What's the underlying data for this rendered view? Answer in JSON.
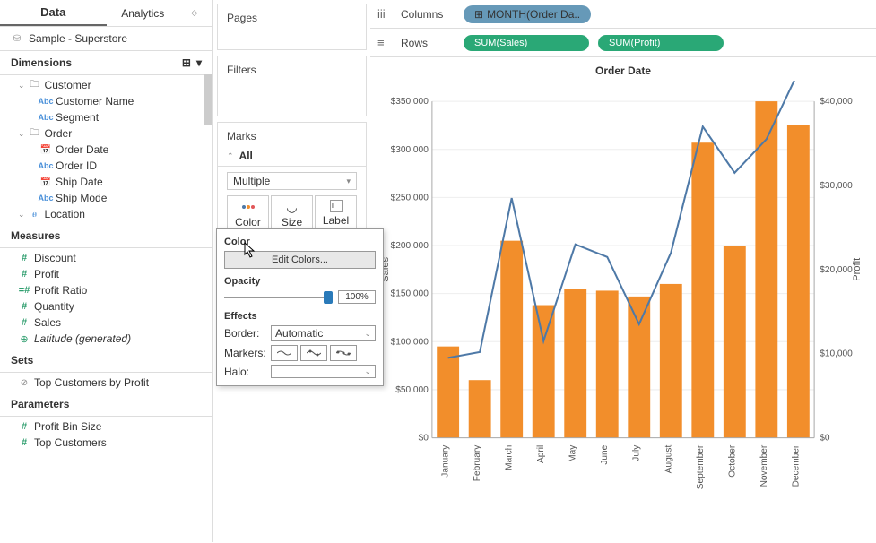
{
  "tabs": {
    "data": "Data",
    "analytics": "Analytics"
  },
  "datasource": "Sample - Superstore",
  "dimensions_hdr": "Dimensions",
  "measures_hdr": "Measures",
  "sets_hdr": "Sets",
  "parameters_hdr": "Parameters",
  "dimensions": {
    "customer": "Customer",
    "customer_name": "Customer Name",
    "segment": "Segment",
    "order": "Order",
    "order_date": "Order Date",
    "order_id": "Order ID",
    "ship_date": "Ship Date",
    "ship_mode": "Ship Mode",
    "location": "Location"
  },
  "measures": {
    "discount": "Discount",
    "profit": "Profit",
    "profit_ratio": "Profit Ratio",
    "quantity": "Quantity",
    "sales": "Sales",
    "latitude": "Latitude (generated)"
  },
  "sets": {
    "top_customers": "Top Customers by Profit"
  },
  "parameters": {
    "profit_bin": "Profit Bin Size",
    "top_cust": "Top Customers"
  },
  "cards": {
    "pages": "Pages",
    "filters": "Filters",
    "marks": "Marks",
    "all": "All",
    "multiple": "Multiple",
    "color": "Color",
    "size": "Size",
    "label": "Label"
  },
  "popup": {
    "color": "Color",
    "edit": "Edit Colors...",
    "opacity": "Opacity",
    "opacity_val": "100%",
    "effects": "Effects",
    "border": "Border:",
    "automatic": "Automatic",
    "markers": "Markers:",
    "halo": "Halo:"
  },
  "shelves": {
    "columns": "Columns",
    "rows": "Rows",
    "col_pill": "MONTH(Order Da..",
    "row_pill1": "SUM(Sales)",
    "row_pill2": "SUM(Profit)"
  },
  "chart_title": "Order Date",
  "y1_label": "Sales",
  "y2_label": "Profit",
  "chart_data": {
    "type": "bar+line",
    "categories": [
      "January",
      "February",
      "March",
      "April",
      "May",
      "June",
      "July",
      "August",
      "September",
      "October",
      "November",
      "December"
    ],
    "series": [
      {
        "name": "Sales",
        "type": "bar",
        "axis": "left",
        "values": [
          95000,
          60000,
          205000,
          138000,
          155000,
          153000,
          147000,
          160000,
          307000,
          200000,
          350000,
          325000
        ]
      },
      {
        "name": "Profit",
        "type": "line",
        "axis": "right",
        "values": [
          9500,
          10200,
          28500,
          11500,
          23000,
          21500,
          13500,
          22000,
          37000,
          31500,
          35500,
          43500
        ]
      }
    ],
    "y1": {
      "label": "Sales",
      "ticks": [
        0,
        50000,
        100000,
        150000,
        200000,
        250000,
        300000,
        350000
      ],
      "tick_labels": [
        "$0",
        "$50,000",
        "$100,000",
        "$150,000",
        "$200,000",
        "$250,000",
        "$300,000",
        "$350,000"
      ]
    },
    "y2": {
      "label": "Profit",
      "ticks": [
        0,
        10000,
        20000,
        30000,
        40000
      ],
      "tick_labels": [
        "$0",
        "$10,000",
        "$20,000",
        "$30,000",
        "$40,000"
      ]
    },
    "title": "Order Date"
  }
}
